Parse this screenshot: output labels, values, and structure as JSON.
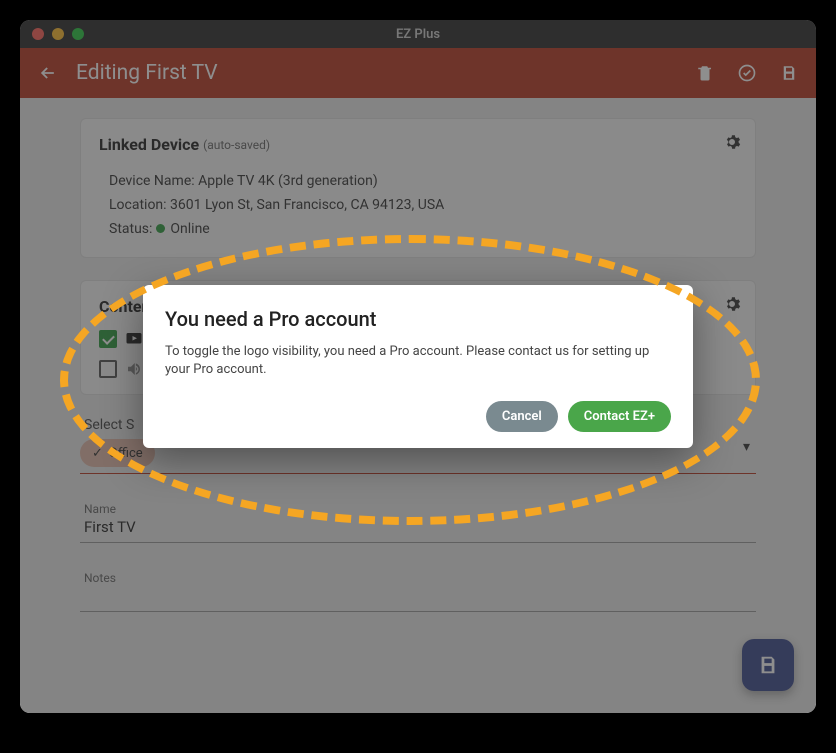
{
  "window": {
    "title": "EZ Plus"
  },
  "appbar": {
    "page_title": "Editing First TV"
  },
  "linked_device": {
    "card_title": "Linked Device",
    "card_sub": "(auto-saved)",
    "name_label": "Device Name:",
    "name_value": "Apple TV 4K (3rd generation)",
    "location_label": "Location:",
    "location_value": "3601 Lyon St, San Francisco, CA 94123, USA",
    "status_label": "Status:",
    "status_value": "Online"
  },
  "content_setup": {
    "card_title": "Content & Setup",
    "checks": [
      {
        "checked": true,
        "icon": "playlist"
      },
      {
        "checked": false,
        "icon": "audio"
      }
    ]
  },
  "select_section": {
    "label": "Select S",
    "chip": "Office"
  },
  "name_field": {
    "label": "Name",
    "value": "First TV"
  },
  "notes_field": {
    "label": "Notes",
    "value": ""
  },
  "dialog": {
    "title": "You need a Pro account",
    "body": "To toggle the logo visibility, you need a Pro account. Please contact us for setting up your Pro account.",
    "cancel": "Cancel",
    "confirm": "Contact EZ+"
  }
}
